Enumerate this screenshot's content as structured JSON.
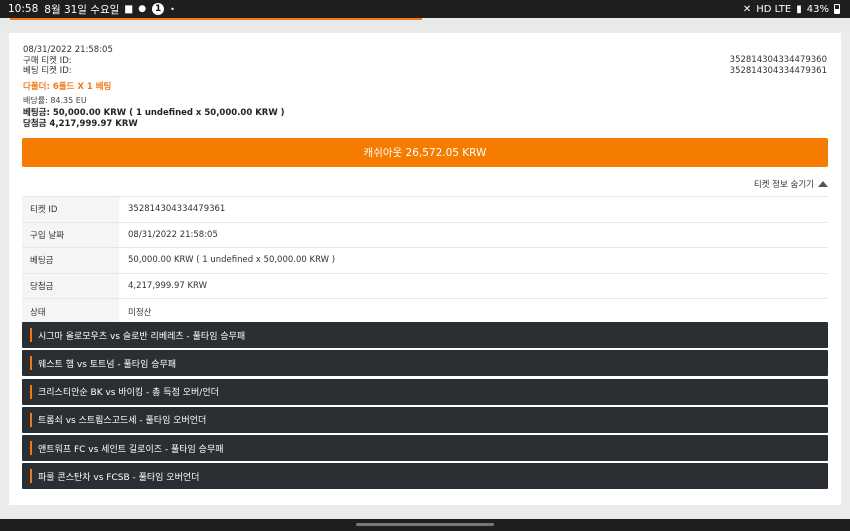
{
  "status_bar": {
    "time": "10:58",
    "date": "8월 31일 수요일",
    "notification_count": "1",
    "network": "HD LTE",
    "battery": "43%"
  },
  "colors": {
    "accent": "#f57c00",
    "match_bg": "#2b2e33"
  },
  "ticket": {
    "datetime": "08/31/2022 21:58:05",
    "purchase_id_label": "구매 티켓 ID:",
    "purchase_id": "352814304334479360",
    "bet_id_label": "베팅 티켓 ID:",
    "bet_id": "352814304334479361",
    "combo": "다폴더: 6폴드 X 1 베팅",
    "odds": "배당률: 84.35 EU",
    "stake": "베팅금: 50,000.00 KRW ( 1 undefined x 50,000.00 KRW )",
    "payout": "당첨금 4,217,999.97 KRW"
  },
  "cashout_button": "캐쉬아웃 26,572.05 KRW",
  "hide_info_label": "티켓 정보 숨기기",
  "details": [
    {
      "key": "티켓 ID",
      "value": "352814304334479361"
    },
    {
      "key": "구입 날짜",
      "value": "08/31/2022 21:58:05"
    },
    {
      "key": "베팅금",
      "value": "50,000.00 KRW ( 1 undefined x 50,000.00 KRW )"
    },
    {
      "key": "당첨금",
      "value": "4,217,999.97 KRW"
    },
    {
      "key": "상태",
      "value": "미정산"
    }
  ],
  "matches": [
    "시그마 올로모우츠 vs 슬로반 리베레츠 - 풀타임 승무패",
    "웨스트 햄 vs 토트넘 - 풀타임 승무패",
    "크리스티안순 BK vs 바이킹 - 총 득점 오버/언더",
    "트롬쇠 vs 스트룀스고드세 - 풀타임 오버언더",
    "앤트워프 FC vs 세인트 길로이즈 - 풀타임 승무패",
    "파룰 콘스탄차 vs FCSB - 풀타임 오버언더"
  ]
}
